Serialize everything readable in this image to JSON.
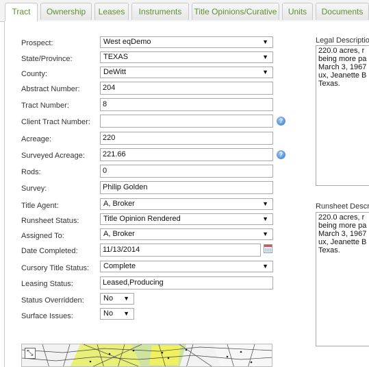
{
  "tabs": [
    "Tract",
    "Ownership",
    "Leases",
    "Instruments",
    "Title Opinions/Curative",
    "Units",
    "Documents"
  ],
  "form": {
    "prospect": {
      "label": "Prospect:",
      "value": "West eqDemo"
    },
    "state": {
      "label": "State/Province:",
      "value": "TEXAS"
    },
    "county": {
      "label": "County:",
      "value": "DeWitt"
    },
    "abstract_number": {
      "label": "Abstract Number:",
      "value": "204"
    },
    "tract_number": {
      "label": "Tract Number:",
      "value": "8"
    },
    "client_tract_number": {
      "label": "Client Tract Number:",
      "value": ""
    },
    "acreage": {
      "label": "Acreage:",
      "value": "220"
    },
    "surveyed_acreage": {
      "label": "Surveyed Acreage:",
      "value": "221.66"
    },
    "rods": {
      "label": "Rods:",
      "value": "0"
    },
    "survey": {
      "label": "Survey:",
      "value": "Philip Golden"
    },
    "title_agent": {
      "label": "Title Agent:",
      "value": "A, Broker"
    },
    "runsheet_status": {
      "label": "Runsheet Status:",
      "value": "Title Opinion Rendered"
    },
    "assigned_to": {
      "label": "Assigned To:",
      "value": "A, Broker"
    },
    "date_completed": {
      "label": "Date Completed:",
      "value": "11/13/2014"
    },
    "cursory_title_status": {
      "label": "Cursory Title Status:",
      "value": "Complete"
    },
    "leasing_status": {
      "label": "Leasing Status:",
      "value": "Leased,Producing"
    },
    "status_overridden": {
      "label": "Status Overridden:",
      "value": "No"
    },
    "surface_issues": {
      "label": "Surface Issues:",
      "value": "No"
    }
  },
  "legal_description": {
    "label": "Legal Description",
    "text": "220.0 acres, r\nbeing more pa\nMarch 3, 1967\nux, Jeanette B\nTexas."
  },
  "runsheet_description": {
    "label": "Runsheet Descri",
    "text": "220.0 acres, r\nbeing more pa\nMarch 3, 1967\nux, Jeanette B\nTexas."
  },
  "icons": {
    "help": "help-icon",
    "calendar": "calendar-icon",
    "dropdown": "dropdown-arrow-icon",
    "map_expand": "expand-map-icon"
  }
}
